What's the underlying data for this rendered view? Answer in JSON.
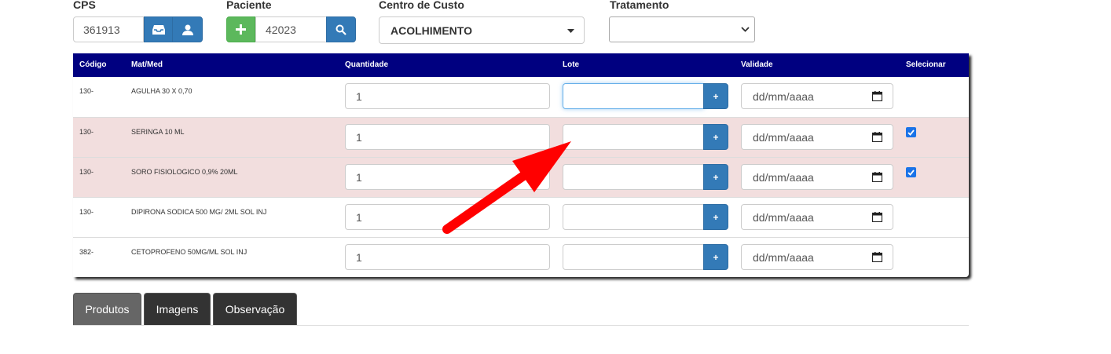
{
  "form": {
    "cps_label": "CPS",
    "cps_value": "361913",
    "paciente_label": "Paciente",
    "paciente_value": "42023",
    "centro_label": "Centro de Custo",
    "centro_value": "ACOLHIMENTO",
    "tratamento_label": "Tratamento",
    "tratamento_value": ""
  },
  "table": {
    "headers": [
      "Código",
      "Mat/Med",
      "Quantidade",
      "Lote",
      "Validade",
      "Selecionar"
    ],
    "rows": [
      {
        "codigo": "130-",
        "matmed": "AGULHA 30 X 0,70",
        "quantidade": "1",
        "lote": "",
        "validade_placeholder": "dd/mm/aaaa",
        "selecionado": false
      },
      {
        "codigo": "130-",
        "matmed": "SERINGA 10 ML",
        "quantidade": "1",
        "lote": "",
        "validade_placeholder": "dd/mm/aaaa",
        "selecionado": true
      },
      {
        "codigo": "130-",
        "matmed": "SORO FISIOLOGICO 0,9% 20ML",
        "quantidade": "1",
        "lote": "",
        "validade_placeholder": "dd/mm/aaaa",
        "selecionado": true
      },
      {
        "codigo": "130-",
        "matmed": "DIPIRONA SODICA 500 MG/ 2ML SOL INJ",
        "quantidade": "1",
        "lote": "",
        "validade_placeholder": "dd/mm/aaaa",
        "selecionado": false
      },
      {
        "codigo": "382-",
        "matmed": "CETOPROFENO 50MG/ML SOL INJ",
        "quantidade": "1",
        "lote": "",
        "validade_placeholder": "dd/mm/aaaa",
        "selecionado": false
      }
    ],
    "lote_button_label": "+"
  },
  "tabs": [
    {
      "label": "Produtos",
      "active": true
    },
    {
      "label": "Imagens",
      "active": false
    },
    {
      "label": "Observação",
      "active": false
    }
  ],
  "colors": {
    "header_bg": "#000080",
    "selected_row_bg": "#f2dede",
    "primary": "#337ab7",
    "success": "#5cb85c",
    "annotation_arrow": "#ff0000"
  },
  "icons": [
    "inbox-icon",
    "user-icon",
    "plus-icon",
    "search-icon",
    "caret-down-icon",
    "chevron-down-icon",
    "calendar-icon",
    "checkbox-icon",
    "arrow-annotation"
  ]
}
